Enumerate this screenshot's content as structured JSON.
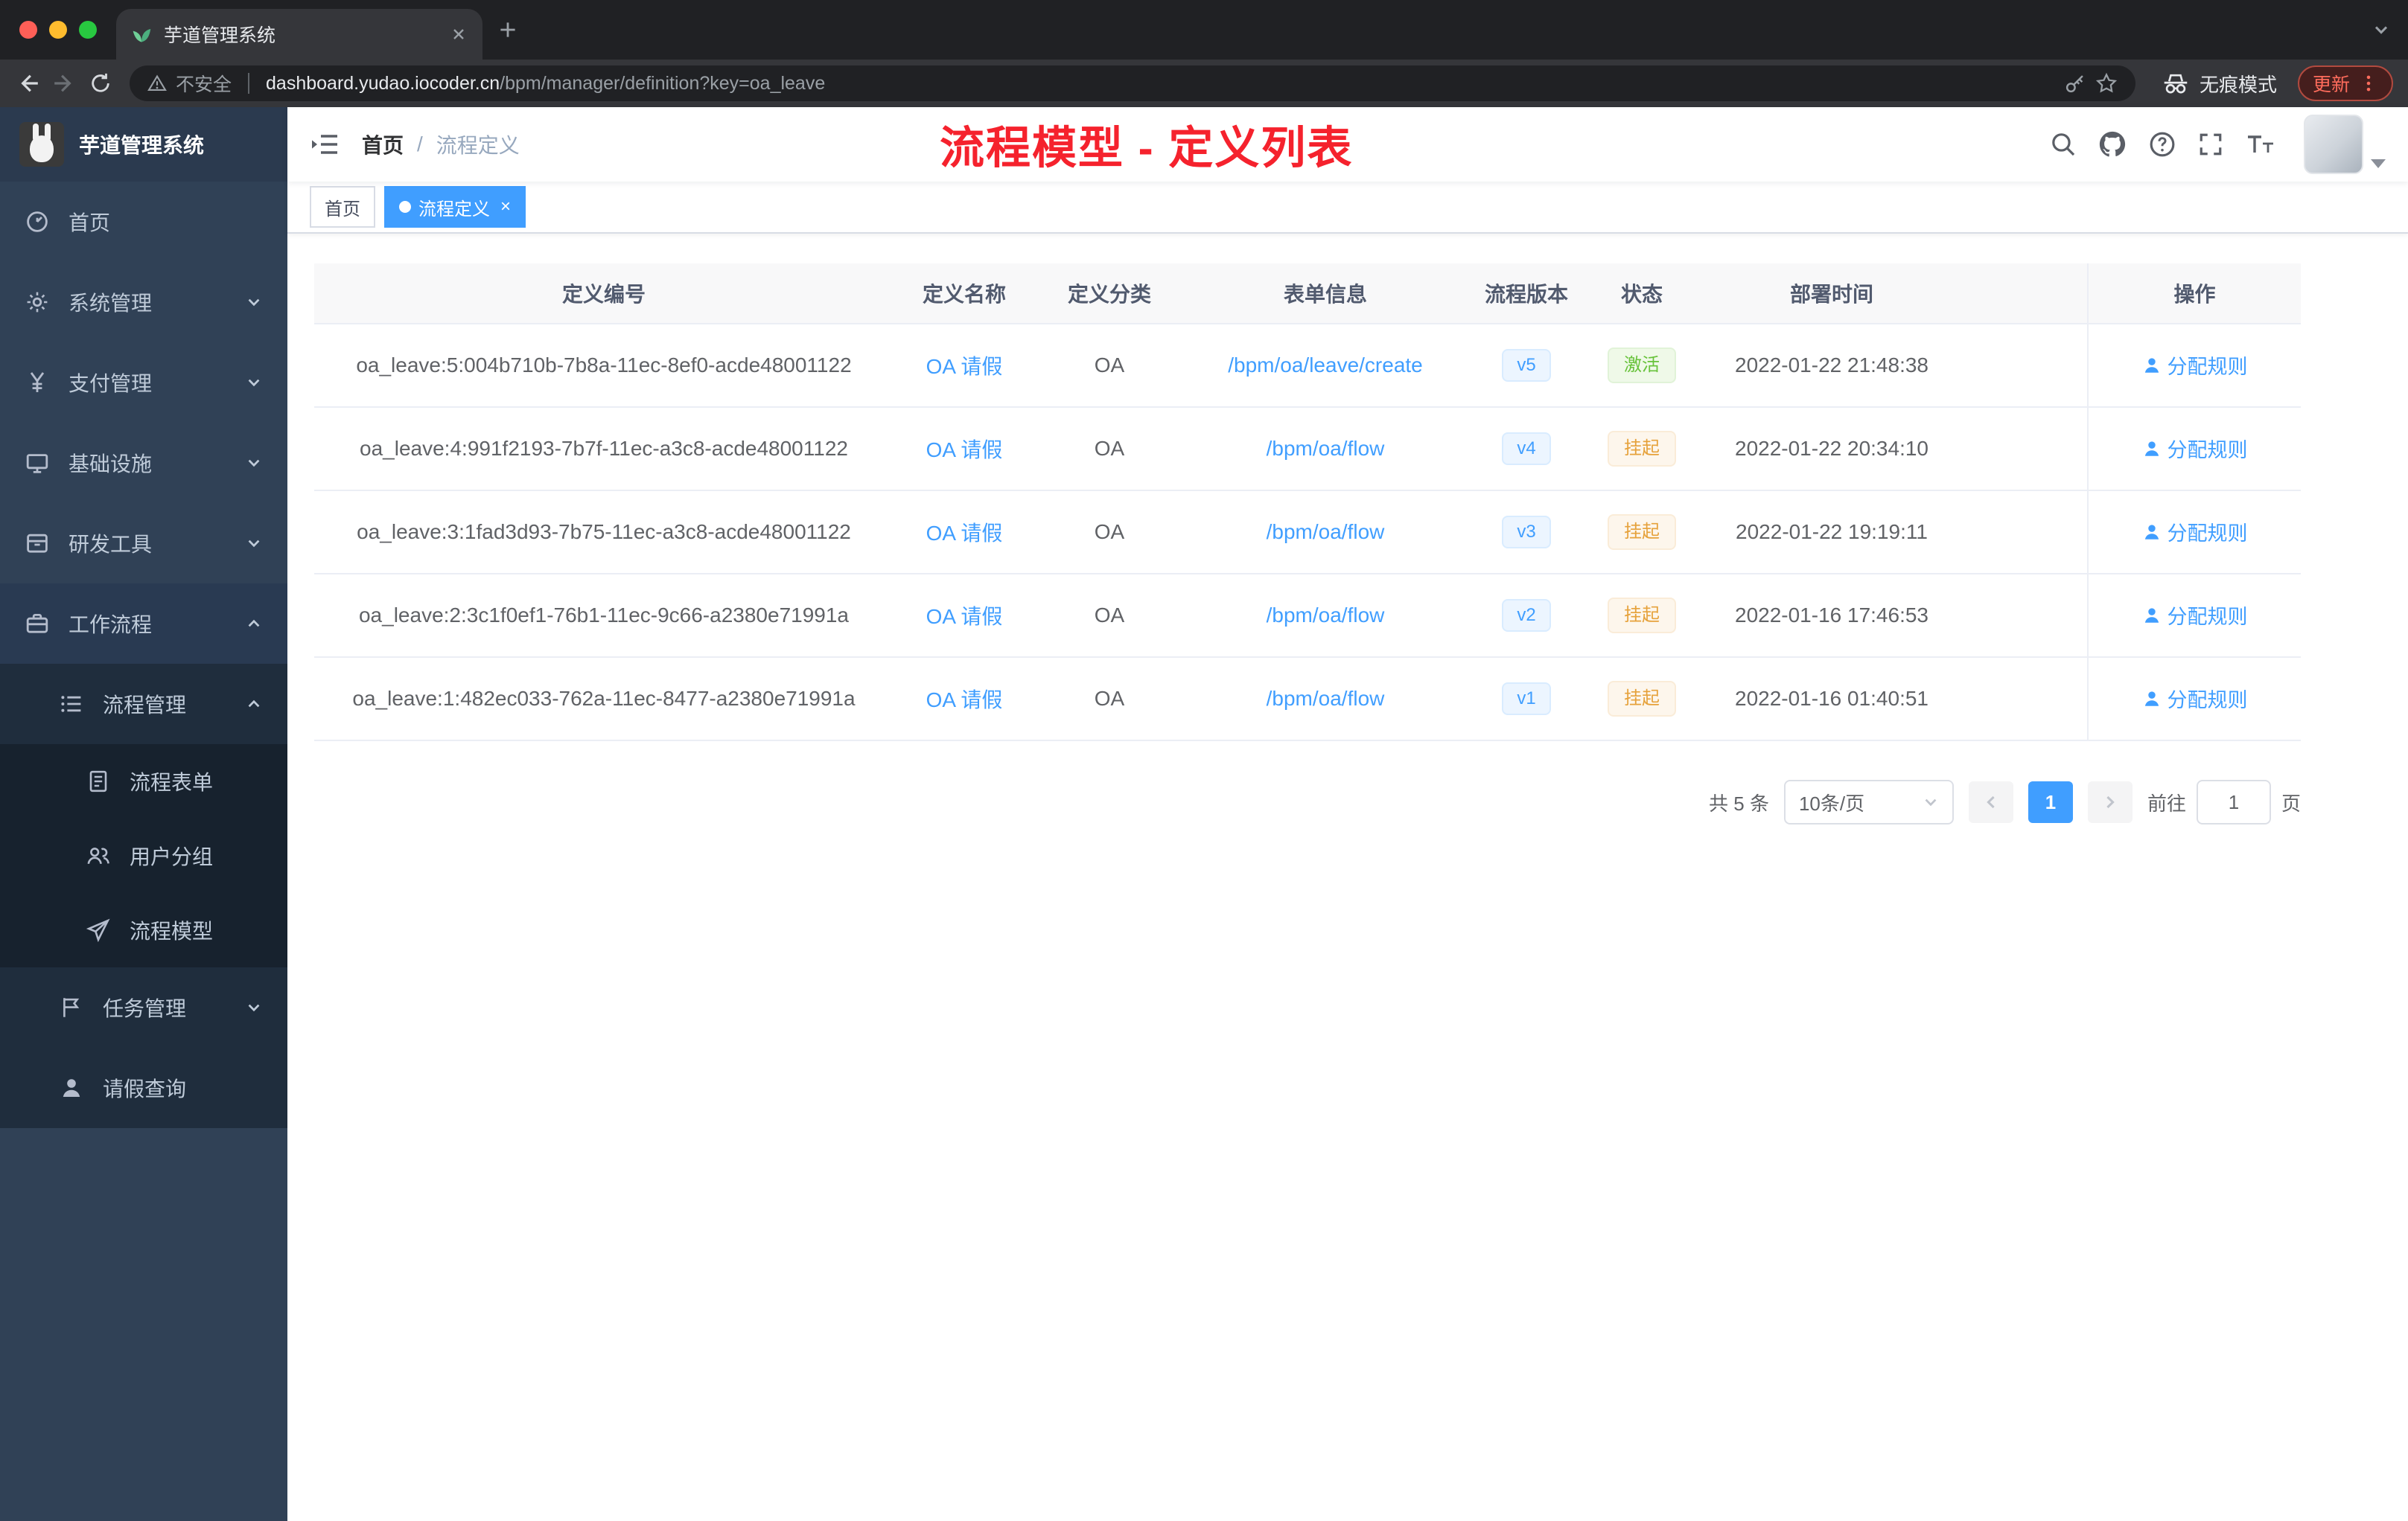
{
  "browser": {
    "tab_title": "芋道管理系统",
    "security_label": "不安全",
    "url_host": "dashboard.yudao.iocoder.cn",
    "url_path": "/bpm/manager/definition?key=oa_leave",
    "incognito_label": "无痕模式",
    "update_label": "更新"
  },
  "sidebar": {
    "logo_title": "芋道管理系统",
    "items": [
      {
        "label": "首页"
      },
      {
        "label": "系统管理"
      },
      {
        "label": "支付管理"
      },
      {
        "label": "基础设施"
      },
      {
        "label": "研发工具"
      },
      {
        "label": "工作流程"
      },
      {
        "label": "流程管理"
      },
      {
        "label": "流程表单"
      },
      {
        "label": "用户分组"
      },
      {
        "label": "流程模型"
      },
      {
        "label": "任务管理"
      },
      {
        "label": "请假查询"
      }
    ]
  },
  "navbar": {
    "breadcrumb_home": "首页",
    "breadcrumb_separator": "/",
    "breadcrumb_current": "流程定义",
    "annotation": "流程模型 - 定义列表"
  },
  "tags": {
    "home": "首页",
    "active": "流程定义"
  },
  "table": {
    "columns": [
      "定义编号",
      "定义名称",
      "定义分类",
      "表单信息",
      "流程版本",
      "状态",
      "部署时间",
      "操作"
    ],
    "rows": [
      {
        "id": "oa_leave:5:004b710b-7b8a-11ec-8ef0-acde48001122",
        "name": "OA 请假",
        "category": "OA",
        "form": "/bpm/oa/leave/create",
        "version": "v5",
        "status": "激活",
        "time": "2022-01-22 21:48:38",
        "action": "分配规则"
      },
      {
        "id": "oa_leave:4:991f2193-7b7f-11ec-a3c8-acde48001122",
        "name": "OA 请假",
        "category": "OA",
        "form": "/bpm/oa/flow",
        "version": "v4",
        "status": "挂起",
        "time": "2022-01-22 20:34:10",
        "action": "分配规则"
      },
      {
        "id": "oa_leave:3:1fad3d93-7b75-11ec-a3c8-acde48001122",
        "name": "OA 请假",
        "category": "OA",
        "form": "/bpm/oa/flow",
        "version": "v3",
        "status": "挂起",
        "time": "2022-01-22 19:19:11",
        "action": "分配规则"
      },
      {
        "id": "oa_leave:2:3c1f0ef1-76b1-11ec-9c66-a2380e71991a",
        "name": "OA 请假",
        "category": "OA",
        "form": "/bpm/oa/flow",
        "version": "v2",
        "status": "挂起",
        "time": "2022-01-16 17:46:53",
        "action": "分配规则"
      },
      {
        "id": "oa_leave:1:482ec033-762a-11ec-8477-a2380e71991a",
        "name": "OA 请假",
        "category": "OA",
        "form": "/bpm/oa/flow",
        "version": "v1",
        "status": "挂起",
        "time": "2022-01-16 01:40:51",
        "action": "分配规则"
      }
    ]
  },
  "pagination": {
    "total": "共 5 条",
    "page_size": "10条/页",
    "page": "1",
    "goto_label": "前往",
    "goto_value": "1",
    "page_unit": "页"
  },
  "colors": {
    "accent": "#409eff",
    "success": "#67c23a",
    "warning": "#e6a23c",
    "annotation_red": "#f5222d",
    "sidebar_bg": "#304156",
    "active_tag": "#409eff"
  }
}
